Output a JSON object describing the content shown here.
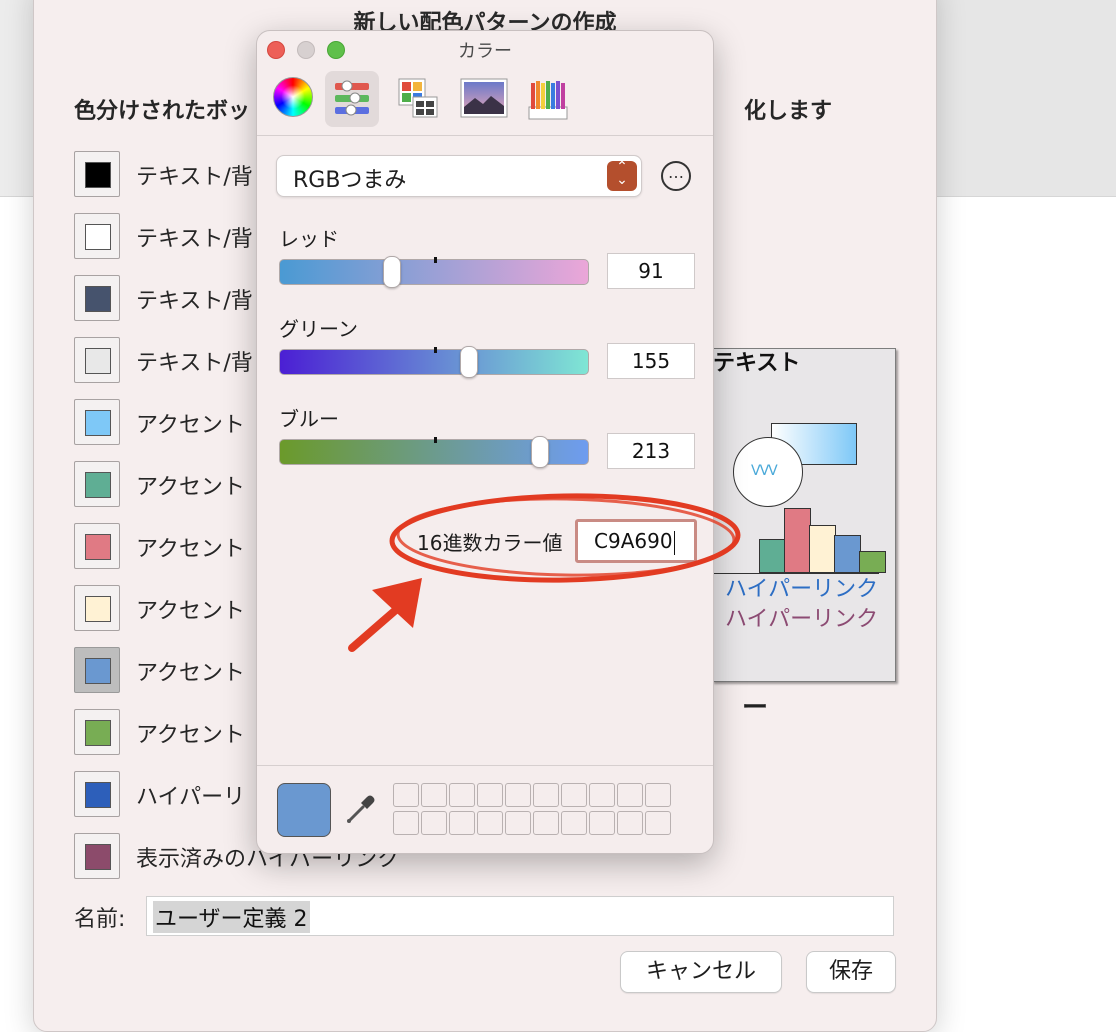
{
  "sheet": {
    "title": "新しい配色パターンの作成",
    "instruction": "色分けされたボッ",
    "instruction_tail": "化します",
    "rows": [
      {
        "label": "テキスト/背",
        "color": "#000000"
      },
      {
        "label": "テキスト/背",
        "color": "#ffffff"
      },
      {
        "label": "テキスト/背",
        "color": "#46536d"
      },
      {
        "label": "テキスト/背",
        "color": "#e8e8e8"
      },
      {
        "label": "アクセント",
        "color": "#7ec8f7"
      },
      {
        "label": "アクセント",
        "color": "#5fae94"
      },
      {
        "label": "アクセント",
        "color": "#e07a84"
      },
      {
        "label": "アクセント",
        "color": "#fff2d4"
      },
      {
        "label": "アクセント",
        "color": "#6a98d0"
      },
      {
        "label": "アクセント",
        "color": "#78ad54"
      },
      {
        "label": "ハイパーリ",
        "color": "#2d5fba"
      },
      {
        "label": "表示済みのハイパーリンク",
        "color": "#8c4b6b"
      }
    ],
    "preview": {
      "title": "テキスト",
      "link": "ハイパーリンク",
      "visited_link": "ハイパーリンク",
      "bars": [
        {
          "color": "#5fae94",
          "value": 45
        },
        {
          "color": "#e07a84",
          "value": 90
        },
        {
          "color": "#fff2d4",
          "value": 65
        },
        {
          "color": "#6a98d0",
          "value": 52
        },
        {
          "color": "#78ad54",
          "value": 28
        }
      ],
      "sample_name_tail": "ー"
    },
    "name_label": "名前:",
    "name_value": "ユーザー定義 2",
    "cancel_label": "キャンセル",
    "save_label": "保存"
  },
  "color_panel": {
    "title": "カラー",
    "mode": "RGBつまみ",
    "sliders": [
      {
        "label": "レッド",
        "value": "91",
        "gradient": "linear-gradient(90deg,#4a9ad3,#eba6d8)",
        "fraction": 0.36,
        "tick": 0.5
      },
      {
        "label": "グリーン",
        "value": "155",
        "gradient": "linear-gradient(90deg,#4b1fd4,#7fe6d4)",
        "fraction": 0.61,
        "tick": 0.5
      },
      {
        "label": "ブルー",
        "value": "213",
        "gradient": "linear-gradient(90deg,#6b9a2a,#6e9cf0)",
        "fraction": 0.84,
        "tick": 0.5
      }
    ],
    "hex_label": "16進数カラー値",
    "hex_value": "C9A690",
    "current_color": "#6a98d0",
    "tools": [
      "color-wheel-icon",
      "color-sliders-icon",
      "color-palettes-icon",
      "image-palettes-icon",
      "pencils-icon"
    ],
    "more_icon": "…"
  },
  "colors": {
    "annotation": "#e23b22",
    "close": "#ed5f57",
    "minimize": "#d7d0d0",
    "zoom": "#5fc04a"
  }
}
